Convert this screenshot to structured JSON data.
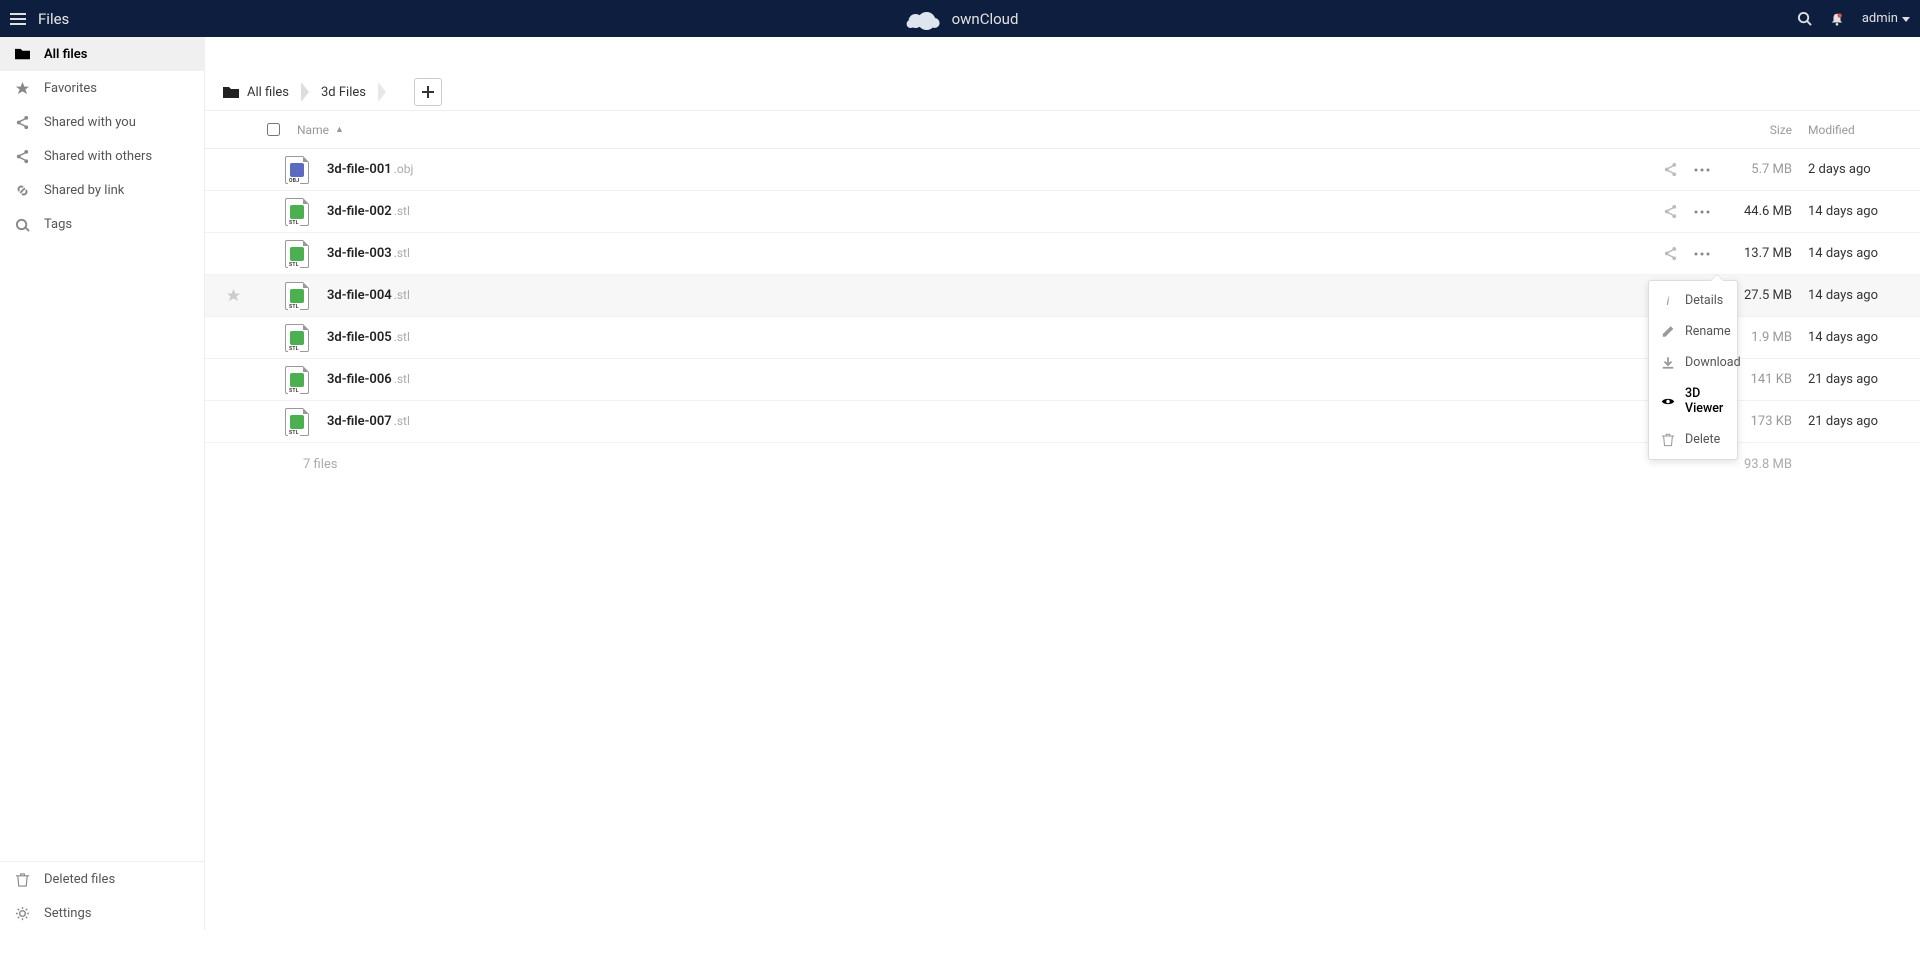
{
  "header": {
    "app_name": "Files",
    "brand": "ownCloud",
    "user": "admin"
  },
  "sidebar": {
    "items": [
      {
        "label": "All files",
        "icon": "folder",
        "active": true
      },
      {
        "label": "Favorites",
        "icon": "star",
        "active": false
      },
      {
        "label": "Shared with you",
        "icon": "share-in",
        "active": false
      },
      {
        "label": "Shared with others",
        "icon": "share-out",
        "active": false
      },
      {
        "label": "Shared by link",
        "icon": "link",
        "active": false
      },
      {
        "label": "Tags",
        "icon": "tag",
        "active": false
      }
    ],
    "footer": [
      {
        "label": "Deleted files",
        "icon": "trash"
      },
      {
        "label": "Settings",
        "icon": "gear"
      }
    ]
  },
  "breadcrumb": {
    "root": "All files",
    "current": "3d Files"
  },
  "columns": {
    "name": "Name",
    "size": "Size",
    "modified": "Modified"
  },
  "files": [
    {
      "name": "3d-file-001",
      "ext": ".obj",
      "type": "obj",
      "size": "5.7 MB",
      "modified": "2 days ago",
      "size_dim": true,
      "mod_dim": false,
      "active": false
    },
    {
      "name": "3d-file-002",
      "ext": ".stl",
      "type": "stl",
      "size": "44.6 MB",
      "modified": "14 days ago",
      "size_dim": false,
      "mod_dim": false,
      "active": false
    },
    {
      "name": "3d-file-003",
      "ext": ".stl",
      "type": "stl",
      "size": "13.7 MB",
      "modified": "14 days ago",
      "size_dim": false,
      "mod_dim": false,
      "active": false
    },
    {
      "name": "3d-file-004",
      "ext": ".stl",
      "type": "stl",
      "size": "27.5 MB",
      "modified": "14 days ago",
      "size_dim": false,
      "mod_dim": false,
      "active": true
    },
    {
      "name": "3d-file-005",
      "ext": ".stl",
      "type": "stl",
      "size": "1.9 MB",
      "modified": "14 days ago",
      "size_dim": true,
      "mod_dim": false,
      "active": false
    },
    {
      "name": "3d-file-006",
      "ext": ".stl",
      "type": "stl",
      "size": "141 KB",
      "modified": "21 days ago",
      "size_dim": true,
      "mod_dim": false,
      "active": false
    },
    {
      "name": "3d-file-007",
      "ext": ".stl",
      "type": "stl",
      "size": "173 KB",
      "modified": "21 days ago",
      "size_dim": true,
      "mod_dim": false,
      "active": false
    }
  ],
  "summary": {
    "count": "7 files",
    "total_size": "93.8 MB"
  },
  "context_menu": {
    "items": [
      {
        "label": "Details",
        "icon": "info",
        "highlighted": false
      },
      {
        "label": "Rename",
        "icon": "pencil",
        "highlighted": false
      },
      {
        "label": "Download",
        "icon": "download",
        "highlighted": false
      },
      {
        "label": "3D Viewer",
        "icon": "eye",
        "highlighted": true
      },
      {
        "label": "Delete",
        "icon": "trash",
        "highlighted": false
      }
    ]
  }
}
